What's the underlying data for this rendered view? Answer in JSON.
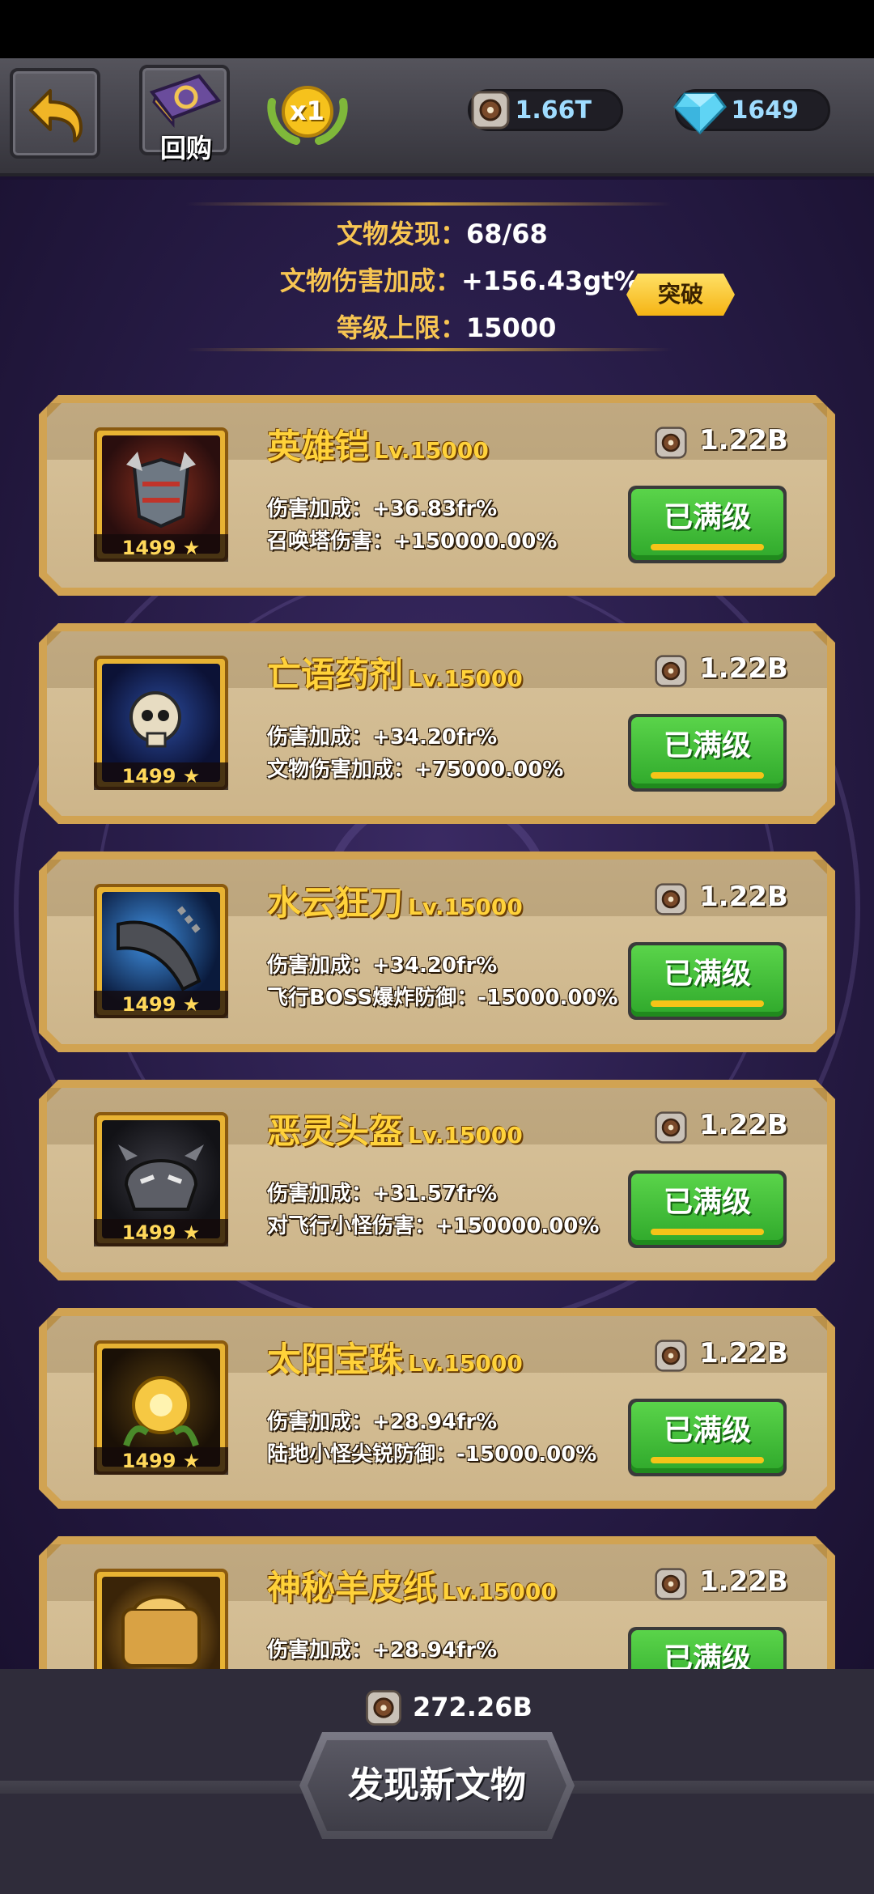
{
  "header": {
    "back_label": "",
    "buyback_label": "回购",
    "multiplier": "x1",
    "resource_coin": "1.66T",
    "resource_gem": "1649"
  },
  "summary": {
    "found_label": "文物发现：",
    "found_value": "68/68",
    "damage_label": "文物伤害加成：",
    "damage_value": "+156.43gt%",
    "level_cap_label": "等级上限：",
    "level_cap_value": "15000",
    "breakthrough_label": "突破"
  },
  "items": [
    {
      "name": "英雄铠",
      "level": "Lv.15000",
      "cost": "1.22B",
      "stat1": "伤害加成：+36.83fr%",
      "stat2": "召唤塔伤害：+150000.00%",
      "portrait_level": "1499",
      "button": "已满级"
    },
    {
      "name": "亡语药剂",
      "level": "Lv.15000",
      "cost": "1.22B",
      "stat1": "伤害加成：+34.20fr%",
      "stat2": "文物伤害加成：+75000.00%",
      "portrait_level": "1499",
      "button": "已满级"
    },
    {
      "name": "水云狂刀",
      "level": "Lv.15000",
      "cost": "1.22B",
      "stat1": "伤害加成：+34.20fr%",
      "stat2": "飞行BOSS爆炸防御：-15000.00%",
      "portrait_level": "1499",
      "button": "已满级"
    },
    {
      "name": "恶灵头盔",
      "level": "Lv.15000",
      "cost": "1.22B",
      "stat1": "伤害加成：+31.57fr%",
      "stat2": "对飞行小怪伤害：+150000.00%",
      "portrait_level": "1499",
      "button": "已满级"
    },
    {
      "name": "太阳宝珠",
      "level": "Lv.15000",
      "cost": "1.22B",
      "stat1": "伤害加成：+28.94fr%",
      "stat2": "陆地小怪尖锐防御：-15000.00%",
      "portrait_level": "1499",
      "button": "已满级"
    },
    {
      "name": "神秘羊皮纸",
      "level": "Lv.15000",
      "cost": "1.22B",
      "stat1": "伤害加成：+28.94fr%",
      "stat2": "",
      "portrait_level": "",
      "button": "已满级"
    }
  ],
  "footer": {
    "total_cost": "272.26B",
    "discover_label": "发现新文物"
  },
  "colors": {
    "accent_gold": "#ffd23a",
    "button_green": "#3fbf35",
    "label_yellow": "#f7c552"
  }
}
